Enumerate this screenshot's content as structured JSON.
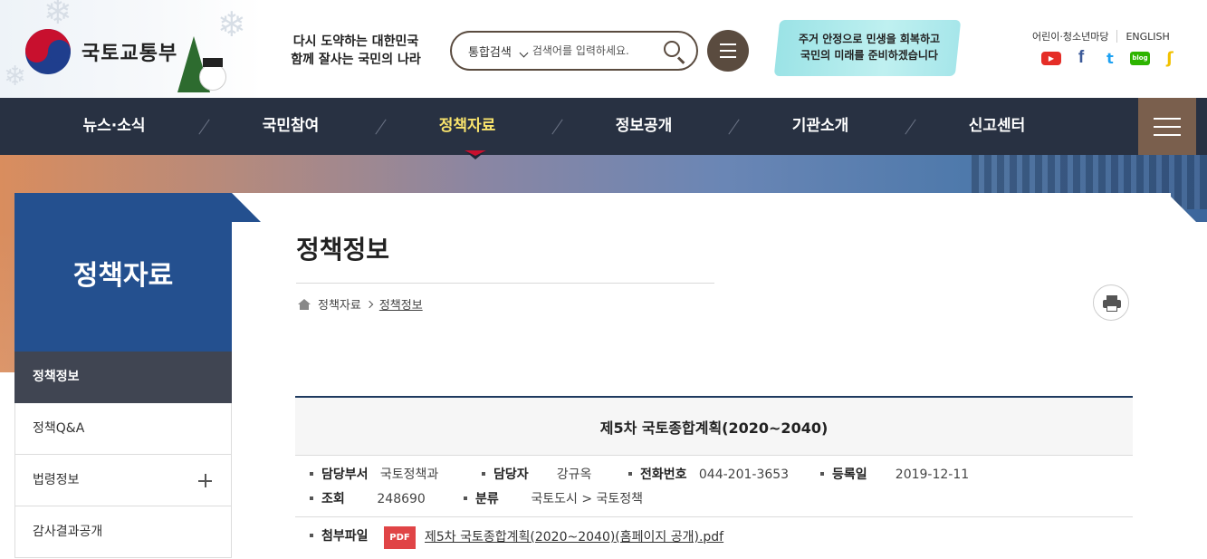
{
  "header": {
    "logo_text": "국토교통부",
    "slogan_line1": "다시 도약하는 대한민국",
    "slogan_line2": "함께 잘사는 국민의 나라",
    "search": {
      "type_label": "통합검색",
      "placeholder": "검색어를 입력하세요."
    },
    "campaign_line1": "주거 안정으로 민생을 회복하고",
    "campaign_line2": "국민의 미래를 준비하겠습니다",
    "top_links": [
      "어린이·청소년마당",
      "ENGLISH"
    ],
    "social": [
      {
        "name": "youtube-icon",
        "glyph": "▶",
        "color": "#e52d27"
      },
      {
        "name": "facebook-icon",
        "glyph": "f",
        "color": "#3b5998"
      },
      {
        "name": "twitter-icon",
        "glyph": "t",
        "color": "#1da1f2"
      },
      {
        "name": "blog-icon",
        "glyph": "blog",
        "color": "#2db400"
      },
      {
        "name": "kakaostory-icon",
        "glyph": "ʃ",
        "color": "#f2c100"
      }
    ]
  },
  "nav": {
    "items": [
      "뉴스·소식",
      "국민참여",
      "정책자료",
      "정보공개",
      "기관소개",
      "신고센터"
    ],
    "active_index": 2,
    "active_color": "#f8e36c",
    "bar_color": "#283142"
  },
  "sidebar": {
    "title": "정책자료",
    "items": [
      {
        "label": "정책정보",
        "active": true
      },
      {
        "label": "정책Q&A",
        "active": false
      },
      {
        "label": "법령정보",
        "active": false,
        "expandable": true
      },
      {
        "label": "감사결과공개",
        "active": false
      }
    ]
  },
  "content": {
    "page_title": "정책정보",
    "breadcrumb": [
      "정책자료",
      "정책정보"
    ],
    "article": {
      "title": "제5차 국토종합계획(2020~2040)",
      "meta_row1": [
        {
          "label": "담당부서",
          "value": "국토정책과"
        },
        {
          "label": "담당자",
          "value": "강규옥"
        },
        {
          "label": "전화번호",
          "value": "044-201-3653"
        },
        {
          "label": "등록일",
          "value": "2019-12-11"
        }
      ],
      "meta_row2": [
        {
          "label": "조회",
          "value": "248690"
        },
        {
          "label": "분류",
          "value": "국토도시 > 국토정책"
        }
      ],
      "attachment_label": "첨부파일",
      "attachment_badge": "PDF",
      "attachment_file": "제5차 국토종합계획(2020~2040)(홈페이지 공개).pdf"
    }
  }
}
